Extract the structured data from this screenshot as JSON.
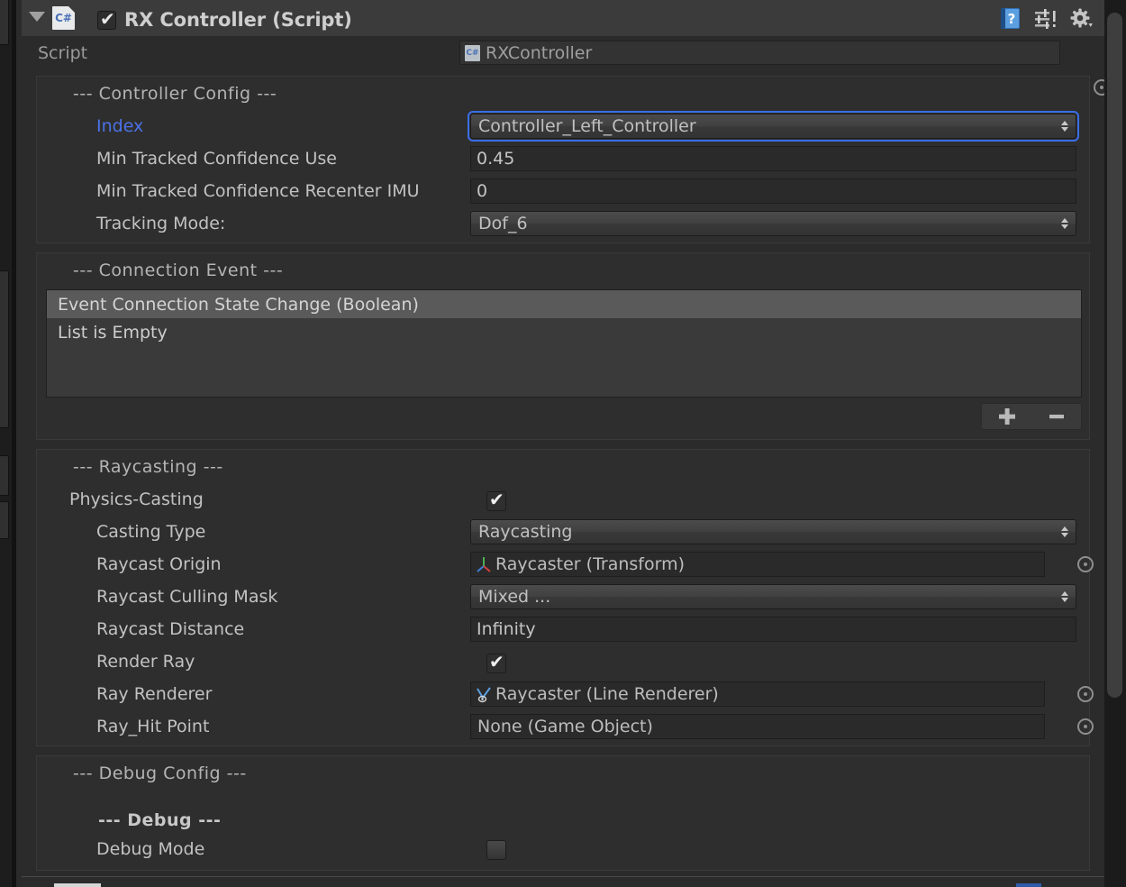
{
  "component": {
    "title": "RX Controller (Script)",
    "enabled_checkbox": true,
    "foldout_expanded": true,
    "script_icon": "csharp-script-icon",
    "header_icons": [
      "help-icon",
      "preset-icon",
      "gear-icon"
    ]
  },
  "script_row": {
    "label": "Script",
    "value": "RXController",
    "icon": "csharp-script-icon"
  },
  "sections": {
    "controller_config": {
      "title": "--- Controller Config ---",
      "fields": {
        "index": {
          "label": "Index",
          "value": "Controller_Left_Controller",
          "type": "popup",
          "focused": true,
          "label_color": "#4b72e8"
        },
        "min_conf_use": {
          "label": "Min Tracked Confidence Use",
          "value": "0.45",
          "type": "text"
        },
        "min_conf_recenter": {
          "label": "Min Tracked Confidence Recenter IMU",
          "value": "0",
          "type": "text"
        },
        "tracking_mode": {
          "label": "Tracking Mode:",
          "value": "Dof_6",
          "type": "popup"
        }
      }
    },
    "connection_event": {
      "title": "--- Connection Event ---",
      "event_header": "Event Connection State Change (Boolean)",
      "empty_text": "List is Empty",
      "add_button": "+",
      "remove_button": "−"
    },
    "raycasting": {
      "title": "--- Raycasting ---",
      "fields": {
        "physics_casting": {
          "label": "Physics-Casting",
          "value": true,
          "type": "checkbox"
        },
        "casting_type": {
          "label": "Casting Type",
          "value": "Raycasting",
          "type": "popup"
        },
        "raycast_origin": {
          "label": "Raycast Origin",
          "value": "Raycaster (Transform)",
          "type": "object",
          "icon": "transform-gizmo-icon"
        },
        "raycast_culling_mask": {
          "label": "Raycast Culling Mask",
          "value": "Mixed ...",
          "type": "popup"
        },
        "raycast_distance": {
          "label": "Raycast Distance",
          "value": "Infinity",
          "type": "text"
        },
        "render_ray": {
          "label": "Render Ray",
          "value": true,
          "type": "checkbox"
        },
        "ray_renderer": {
          "label": "Ray Renderer",
          "value": "Raycaster (Line Renderer)",
          "type": "object",
          "icon": "line-renderer-icon"
        },
        "ray_hit_point": {
          "label": "Ray_Hit Point",
          "value": "None (Game Object)",
          "type": "object"
        }
      }
    },
    "debug_config": {
      "title": "--- Debug Config ---",
      "subtitle": "--- Debug ---",
      "fields": {
        "debug_mode": {
          "label": "Debug Mode",
          "value": false,
          "type": "checkbox"
        }
      }
    }
  },
  "colors": {
    "panel_bg": "#2b2b2b",
    "header_bg": "#3b3b3b",
    "box_bg": "#2e2e2e",
    "accent_blue": "#4b72e8",
    "focus_ring": "#3a6ee8",
    "text": "#c2c2c2"
  }
}
